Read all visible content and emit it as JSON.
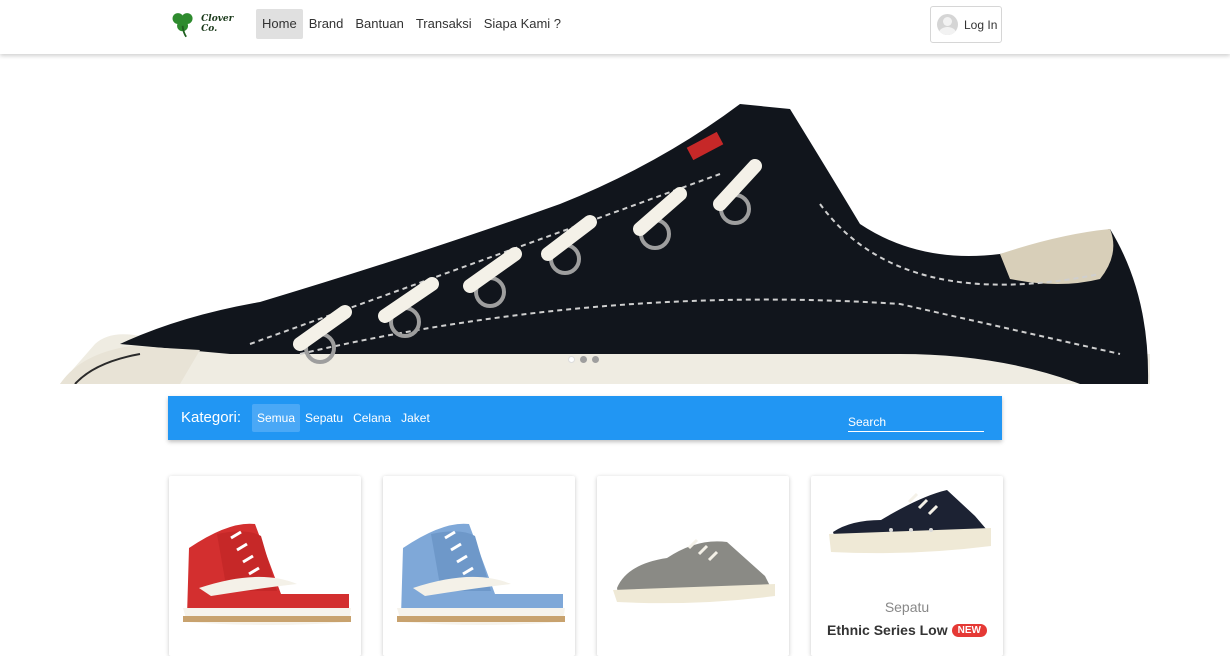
{
  "brand": {
    "logo_text": "Clover Co."
  },
  "nav": {
    "items": [
      {
        "label": "Home",
        "active": true
      },
      {
        "label": "Brand",
        "active": false
      },
      {
        "label": "Bantuan",
        "active": false
      },
      {
        "label": "Transaksi",
        "active": false
      },
      {
        "label": "Siapa Kami ?",
        "active": false
      }
    ],
    "login_label": "Log In"
  },
  "hero": {
    "slide_count": 3,
    "active_slide": 1
  },
  "category_bar": {
    "title": "Kategori:",
    "tabs": [
      {
        "label": "Semua",
        "active": true
      },
      {
        "label": "Sepatu",
        "active": false
      },
      {
        "label": "Celana",
        "active": false
      },
      {
        "label": "Jaket",
        "active": false
      }
    ],
    "search_placeholder": "Search"
  },
  "products": [
    {
      "category": "",
      "name": "",
      "color": "#d32f2f",
      "style": "high-top"
    },
    {
      "category": "",
      "name": "",
      "color": "#7fa8d8",
      "style": "high-top"
    },
    {
      "category": "",
      "name": "",
      "color": "#8a8a85",
      "style": "low-top"
    },
    {
      "category": "Sepatu",
      "name": "Ethnic Series Low",
      "badge": "NEW",
      "color": "#1c2233",
      "style": "low-top"
    }
  ],
  "colors": {
    "accent": "#2196f3",
    "badge": "#e53935"
  }
}
